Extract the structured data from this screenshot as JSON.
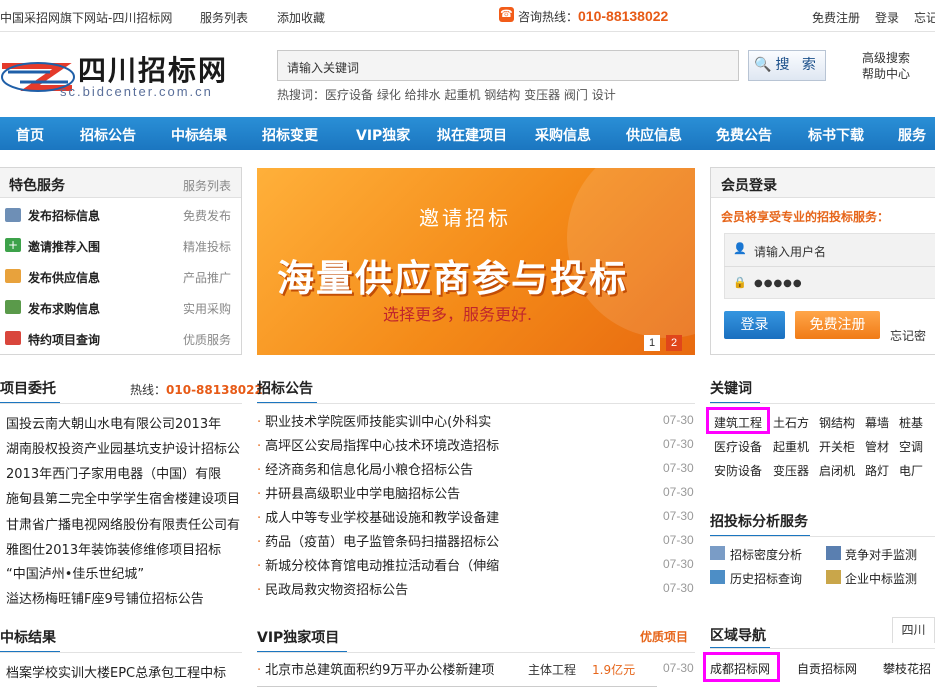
{
  "topbar": {
    "site_note": "中国采招网旗下网站-四川招标网",
    "service_list": "服务列表",
    "add_favorite": "添加收藏",
    "hotline_label": "咨询热线：",
    "hotline_number": "010-88138022",
    "register": "免费注册",
    "login": "登录",
    "forgot": "忘记"
  },
  "logo": {
    "name": "四川招标网",
    "domain": "sc.bidcenter.com.cn"
  },
  "search": {
    "placeholder": "请输入关键词",
    "button": "搜 索",
    "hotwords": "热搜词：医疗设备 绿化 给排水 起重机 钢结构 变压器 阀门 设计",
    "advanced": "高级搜索",
    "help": "帮助中心"
  },
  "nav": [
    "首页",
    "招标公告",
    "中标结果",
    "招标变更",
    "VIP独家",
    "拟在建项目",
    "采购信息",
    "供应信息",
    "免费公告",
    "标书下载",
    "服务"
  ],
  "features": {
    "title": "特色服务",
    "more": "服务列表",
    "items": [
      {
        "label": "发布招标信息",
        "note": "免费发布"
      },
      {
        "label": "邀请推荐入围",
        "note": "精准投标"
      },
      {
        "label": "发布供应信息",
        "note": "产品推广"
      },
      {
        "label": "发布求购信息",
        "note": "实用采购"
      },
      {
        "label": "特约项目查询",
        "note": "优质服务"
      }
    ]
  },
  "banner": {
    "line1": "邀请招标",
    "line2": "海量供应商参与投标",
    "line3": "选择更多，服务更好.",
    "pages": [
      "1",
      "2"
    ]
  },
  "member": {
    "title": "会员登录",
    "slogan": "会员将享受专业的招投标服务：",
    "username_placeholder": "请输入用户名",
    "password_mask": "●●●●●",
    "login_button": "登录",
    "register_button": "免费注册",
    "forgot": "忘记密"
  },
  "entrust": {
    "title": "项目委托",
    "hotline_label": "热线：",
    "hotline": "010-88138022",
    "items": [
      "国投云南大朝山水电有限公司2013年",
      "湖南股权投资产业园基坑支护设计招标公",
      "2013年西门子家用电器（中国）有限",
      "施甸县第二完全中学学生宿舍楼建设项目",
      "甘肃省广播电视网络股份有限责任公司有",
      "雅图仕2013年装饰装修维修项目招标",
      "“中国泸州•佳乐世纪城”",
      "溢达杨梅旺铺F座9号铺位招标公告"
    ]
  },
  "announcements": {
    "title": "招标公告",
    "items": [
      {
        "text": "职业技术学院医师技能实训中心(外科实",
        "date": "07-30"
      },
      {
        "text": "高坪区公安局指挥中心技术环境改造招标",
        "date": "07-30"
      },
      {
        "text": "经济商务和信息化局小粮仓招标公告",
        "date": "07-30"
      },
      {
        "text": "井研县高级职业中学电脑招标公告",
        "date": "07-30"
      },
      {
        "text": "成人中等专业学校基础设施和教学设备建",
        "date": "07-30"
      },
      {
        "text": "药品（疫苗）电子监管条码扫描器招标公",
        "date": "07-30"
      },
      {
        "text": "新城分校体育馆电动推拉活动看台（伸缩",
        "date": "07-30"
      },
      {
        "text": "民政局救灾物资招标公告",
        "date": "07-30"
      }
    ]
  },
  "keywords": {
    "title": "关键词",
    "rows": [
      [
        "建筑工程",
        "土石方",
        "钢结构",
        "幕墙",
        "桩基"
      ],
      [
        "医疗设备",
        "起重机",
        "开关柜",
        "管材",
        "空调"
      ],
      [
        "安防设备",
        "变压器",
        "启闭机",
        "路灯",
        "电厂"
      ]
    ]
  },
  "analysis": {
    "title": "招投标分析服务",
    "items": [
      "招标密度分析",
      "竞争对手监测",
      "历史招标查询",
      "企业中标监测"
    ]
  },
  "win_results": {
    "title": "中标结果",
    "items": [
      "档案学校实训大楼EPC总承包工程中标"
    ]
  },
  "vip": {
    "title": "VIP独家项目",
    "more": "优质项目",
    "items": [
      {
        "text": "北京市总建筑面积约9万平办公楼新建项",
        "category": "主体工程",
        "amount": "1.9亿元",
        "date": "07-30"
      }
    ]
  },
  "region": {
    "title": "区域导航",
    "province": "四川",
    "items": [
      "成都招标网",
      "自贡招标网",
      "攀枝花招"
    ]
  },
  "colors": {
    "nav_blue": "#1b76c0",
    "accent_orange": "#e75a16",
    "highlight_magenta": "#ff00ff"
  }
}
